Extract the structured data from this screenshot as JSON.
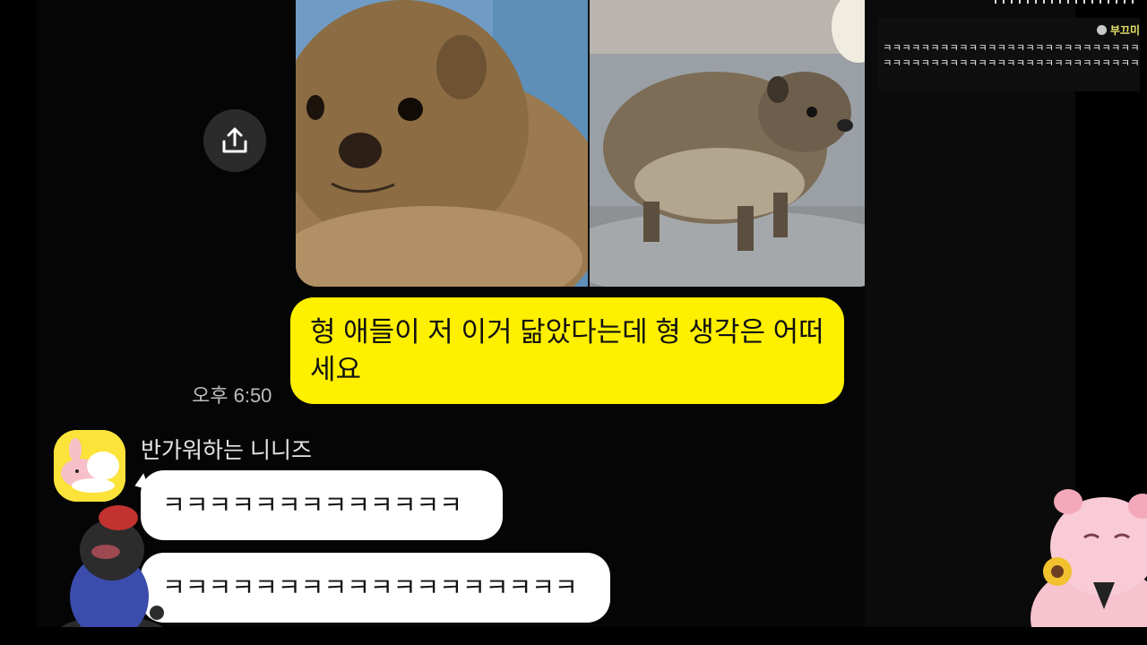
{
  "chat": {
    "my_message": "형 애들이 저 이거 닮았다는데 형 생각은 어떠세요",
    "my_time": "오후 6:50",
    "sender_name": "반가워하는 니니즈",
    "reply_1": "ㅋㅋㅋㅋㅋㅋㅋㅋㅋㅋㅋㅋㅋ",
    "reply_2": "ㅋㅋㅋㅋㅋㅋㅋㅋㅋㅋㅋㅋㅋㅋㅋㅋㅋㅋ"
  },
  "stream_chat": {
    "username": "부끄미",
    "message": "ㅋㅋㅋㅋㅋㅋㅋㅋㅋㅋㅋㅋㅋㅋㅋㅋㅋㅋㅋㅋㅋㅋㅋㅋㅋㅋㅋㅋㅋㅋㅋㅋㅋㅋㅋㅋㅋㅋㅋㅋㅋㅋㅋㅋㅋㅋㅋㅋㅋㅋㅋㅋㅋㅋ"
  },
  "icons": {
    "share": "share-upload-icon"
  },
  "colors": {
    "my_bubble": "#fff000",
    "their_bubble": "#ffffff",
    "background": "#000000",
    "chat_username": "#e8e36a"
  }
}
